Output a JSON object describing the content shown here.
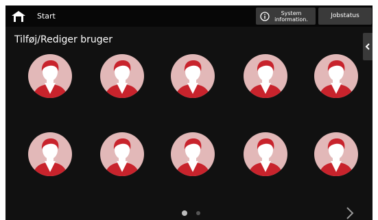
{
  "header": {
    "start_label": "Start",
    "system_info_line1": "System",
    "system_info_line2": "information.",
    "jobstatus_label": "Jobstatus"
  },
  "page": {
    "title": "Tilføj/Rediger bruger"
  },
  "users": {
    "rows": 2,
    "columns": 5,
    "icon": "user-avatar-icon"
  },
  "pagination": {
    "current_page": 1,
    "total_pages": 2
  },
  "colors": {
    "background": "#111111",
    "topbar": "#070707",
    "button": "#3a3a3a",
    "avatar_circle": "#e2b8b8",
    "avatar_accent": "#c8232c"
  }
}
